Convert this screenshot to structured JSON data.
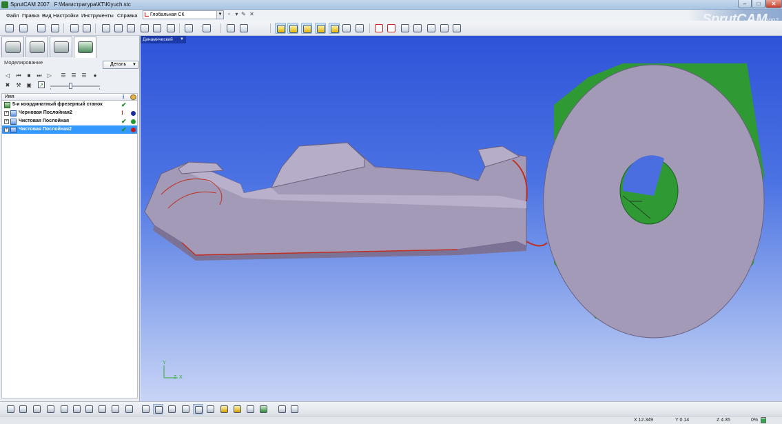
{
  "window": {
    "title": "SprutCAM 2007   F:\\Магистратура\\КТ\\Klyuch.stc",
    "minimize": "–",
    "maximize": "□",
    "close": "✕"
  },
  "menu": [
    "Файл",
    "Правка",
    "Вид",
    "Настройки",
    "Инструменты",
    "Справка"
  ],
  "coordinate_system": {
    "selected": "Глобальная СК"
  },
  "brand": {
    "name": "SprutCAM",
    "year": "2007"
  },
  "left_panel": {
    "tabs": [
      {
        "name": "model-tab",
        "icon": "car-model-icon"
      },
      {
        "name": "workpiece-tab",
        "icon": "cube-wire-icon"
      },
      {
        "name": "stock-tab",
        "icon": "car-stock-icon"
      },
      {
        "name": "machining-tab",
        "icon": "machine-icon"
      }
    ],
    "active_tab": 3,
    "section_title": "Моделирование",
    "detail_select": "Деталь",
    "tree": {
      "column_name": "Имя",
      "column_info": "i",
      "rows": [
        {
          "label": "5-и координатный фрезерный станок",
          "kind": "machine",
          "expandable": false,
          "status_color": ""
        },
        {
          "label": "Черновая Послойная2",
          "kind": "operation",
          "expandable": true,
          "status_color": "#1a2a9a"
        },
        {
          "label": "Чистовая Послойная",
          "kind": "operation",
          "expandable": true,
          "status_color": "#1f9a2a"
        },
        {
          "label": "Чистовая Послойная2",
          "kind": "operation",
          "expandable": true,
          "status_color": "#c41a1a",
          "selected": true
        }
      ]
    }
  },
  "viewport": {
    "view_mode": "Динамический",
    "axes": {
      "y": "Y",
      "z": "Z",
      "x": "X"
    }
  },
  "status": {
    "x": "X 12.349",
    "y": "Y 0.14",
    "z": "Z 4.35",
    "progress_text": "0%",
    "progress_fraction": 0.0
  },
  "colors": {
    "viewport_top": "#2f53d8",
    "viewport_bottom": "#c8d4f6",
    "part_body": "#a39ab8",
    "machined_green": "#2f9a34",
    "edge_red": "#c0301f",
    "selection": "#3399ff"
  }
}
